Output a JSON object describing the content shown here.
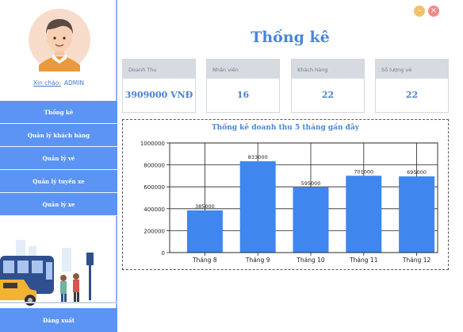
{
  "sidebar": {
    "greeting": "Xin chào:",
    "username": "ADMIN",
    "menu": [
      {
        "label": "Thống kê"
      },
      {
        "label": "Quản lý khách hàng"
      },
      {
        "label": "Quản lý vé"
      },
      {
        "label": "Quản lý tuyến xe"
      },
      {
        "label": "Quản lý xe"
      }
    ],
    "logout": "Đăng xuất"
  },
  "window": {
    "minimize": "–",
    "close": "×"
  },
  "main": {
    "title": "Thống kê",
    "cards": [
      {
        "label": "Doanh Thu",
        "value": "3909000 VNĐ"
      },
      {
        "label": "Nhân viên",
        "value": "16"
      },
      {
        "label": "Khách hàng",
        "value": "22"
      },
      {
        "label": "Số lượng vé",
        "value": "22"
      }
    ]
  },
  "colors": {
    "accent": "#5b94f3",
    "bar": "#3f86ee",
    "title": "#4a85db"
  },
  "chart_data": {
    "type": "bar",
    "title": "Thống kê doanh thu 5 tháng gần đây",
    "categories": [
      "Tháng 8",
      "Tháng 9",
      "Tháng 10",
      "Tháng 11",
      "Tháng 12"
    ],
    "values": [
      385000,
      833000,
      595000,
      701000,
      695000
    ],
    "data_labels": [
      "385000",
      "833000",
      "595000",
      "701000",
      "695000"
    ],
    "ylim": [
      0,
      1000000
    ],
    "yticks": [
      0,
      200000,
      400000,
      600000,
      800000,
      1000000
    ],
    "ytick_labels": [
      "0",
      "200000",
      "400000",
      "600000",
      "800000",
      "1000000"
    ],
    "grid": true,
    "legend": "none"
  }
}
